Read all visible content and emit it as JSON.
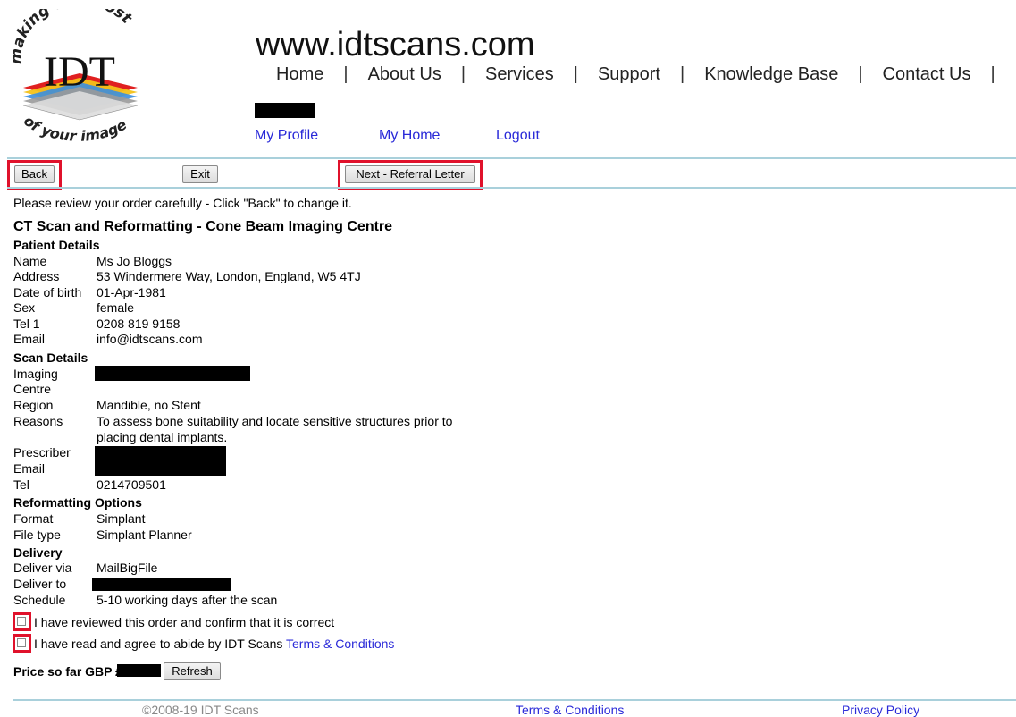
{
  "brand": {
    "logo_text": "IDT",
    "logo_tagline_top": "making the most",
    "logo_tagline_bottom": "of your image",
    "site_url": "www.idtscans.com"
  },
  "main_nav": [
    "Home",
    "About Us",
    "Services",
    "Support",
    "Knowledge Base",
    "Contact Us"
  ],
  "user_nav": {
    "profile": "My Profile",
    "home": "My Home",
    "logout": "Logout"
  },
  "toolbar": {
    "back": "Back",
    "exit": "Exit",
    "next": "Next - Referral Letter"
  },
  "intro": "Please review your order carefully - Click \"Back\" to change it.",
  "order_title": "CT Scan and Reformatting - Cone Beam Imaging Centre",
  "patient": {
    "heading": "Patient Details",
    "name_label": "Name",
    "name": "Ms Jo Bloggs",
    "address_label": "Address",
    "address": "53 Windermere Way, London, England, W5 4TJ",
    "dob_label": "Date of birth",
    "dob": "01-Apr-1981",
    "sex_label": "Sex",
    "sex": "female",
    "tel_label": "Tel 1",
    "tel": "0208 819 9158",
    "email_label": "Email",
    "email": "info@idtscans.com"
  },
  "scan": {
    "heading": "Scan Details",
    "imaging_label_1": "Imaging",
    "imaging_label_2": "Centre",
    "region_label": "Region",
    "region": "Mandible, no Stent",
    "reasons_label": "Reasons",
    "reasons_1": "To assess bone suitability and locate sensitive structures prior to",
    "reasons_2": "placing dental implants.",
    "prescriber_label": "Prescriber",
    "email_label": "Email",
    "tel_label": "Tel",
    "tel": "0214709501"
  },
  "reformatting": {
    "heading": "Reformatting Options",
    "format_label": "Format",
    "format": "Simplant",
    "filetype_label": "File type",
    "filetype": "Simplant Planner"
  },
  "delivery": {
    "heading": "Delivery",
    "via_label": "Deliver via",
    "via": "MailBigFile",
    "to_label": "Deliver to",
    "schedule_label": "Schedule",
    "schedule": "5-10 working days after the scan"
  },
  "confirm": {
    "reviewed": "I have reviewed this order and confirm that it is correct",
    "agree_prefix": "I have read and agree to abide by IDT Scans ",
    "terms_link": "Terms & Conditions"
  },
  "price": {
    "label": "Price so far GBP £",
    "refresh": "Refresh"
  },
  "footer": {
    "copyright": "©2008-19 IDT Scans",
    "terms": "Terms & Conditions",
    "privacy": "Privacy Policy"
  },
  "colors": {
    "link": "#2a2ad8",
    "highlight": "#e0112b",
    "rule": "#a9d0db"
  }
}
